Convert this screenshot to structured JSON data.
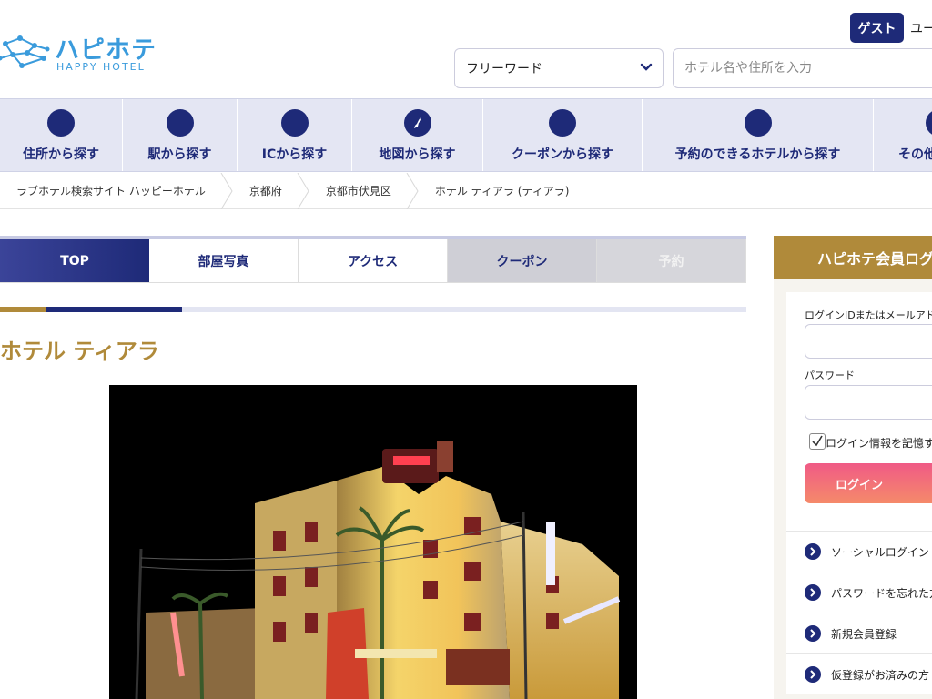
{
  "header": {
    "logo_kana": "ハピホテ",
    "logo_sub": "HAPPY HOTEL",
    "guest_badge": "ゲスト",
    "user_label": "ユー"
  },
  "search": {
    "select_value": "フリーワード",
    "input_placeholder": "ホテル名や住所を入力"
  },
  "nav": {
    "items": [
      {
        "label": "住所から探す",
        "icon": "address-icon"
      },
      {
        "label": "駅から探す",
        "icon": "station-icon"
      },
      {
        "label": "ICから探す",
        "icon": "ic-icon"
      },
      {
        "label": "地図から探す",
        "icon": "map-icon"
      },
      {
        "label": "クーポンから探す",
        "icon": "coupon-icon"
      },
      {
        "label": "予約のできるホテルから探す",
        "icon": "reservation-icon"
      },
      {
        "label": "その他",
        "icon": "other-icon"
      }
    ]
  },
  "breadcrumb": {
    "items": [
      "ラブホテル検索サイト ハッピーホテル",
      "京都府",
      "京都市伏見区",
      "ホテル ティアラ (ティアラ)"
    ]
  },
  "tabs": {
    "items": [
      "TOP",
      "部屋写真",
      "アクセス",
      "クーポン",
      "予約"
    ]
  },
  "hotel": {
    "name": "ホテル ティアラ"
  },
  "login": {
    "heading": "ハピホテ会員ログ",
    "id_label": "ログインIDまたはメールアドレ",
    "password_label": "パスワード",
    "remember_label": "ログイン情報を記憶す",
    "login_button": "ログイン",
    "links": [
      "ソーシャルログイン",
      "パスワードを忘れた方",
      "新規会員登録",
      "仮登録がお済みの方"
    ]
  },
  "colors": {
    "navy": "#1e2a78",
    "gold": "#b08a3a",
    "logo_blue": "#3a9bdc",
    "nav_bg": "#e4e6f3"
  }
}
